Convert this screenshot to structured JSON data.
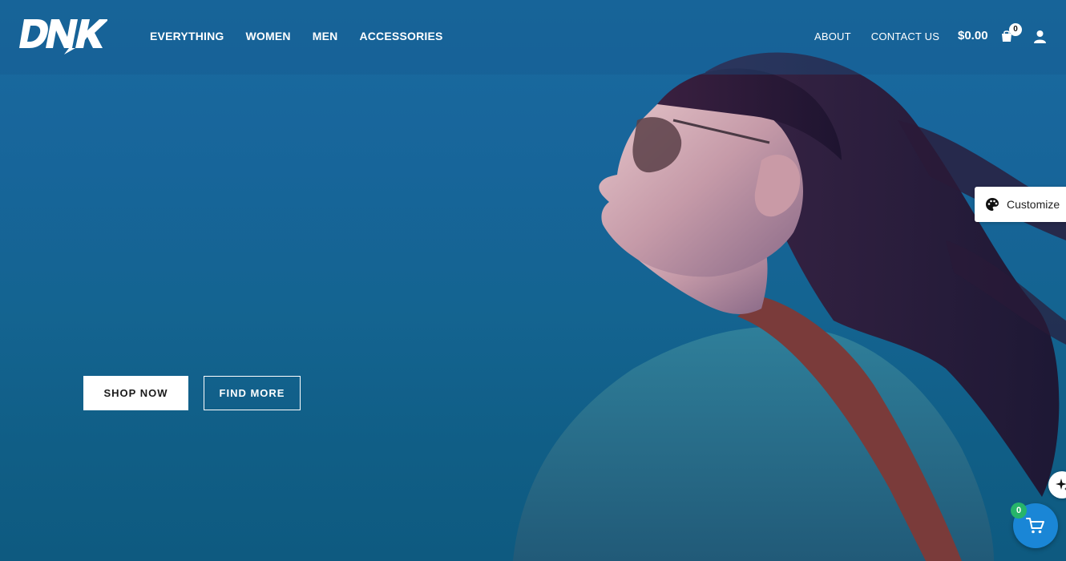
{
  "brand": {
    "logo_text": "DNK"
  },
  "nav": {
    "primary": [
      {
        "label": "EVERYTHING"
      },
      {
        "label": "WOMEN"
      },
      {
        "label": "MEN"
      },
      {
        "label": "ACCESSORIES"
      }
    ],
    "secondary": [
      {
        "label": "ABOUT"
      },
      {
        "label": "CONTACT US"
      }
    ]
  },
  "cart": {
    "total": "$0.00",
    "count": "0"
  },
  "hero": {
    "primary_button": "SHOP NOW",
    "secondary_button": "FIND MORE"
  },
  "customize": {
    "label": "Customize"
  },
  "floating_cart": {
    "count": "0"
  },
  "colors": {
    "hero_background": "#17659a",
    "floating_cart": "#1a86d6",
    "badge_green": "#27b46a"
  },
  "icons": [
    "shopping-bag-icon",
    "user-icon",
    "palette-icon",
    "sparkle-icon",
    "cart-icon"
  ]
}
